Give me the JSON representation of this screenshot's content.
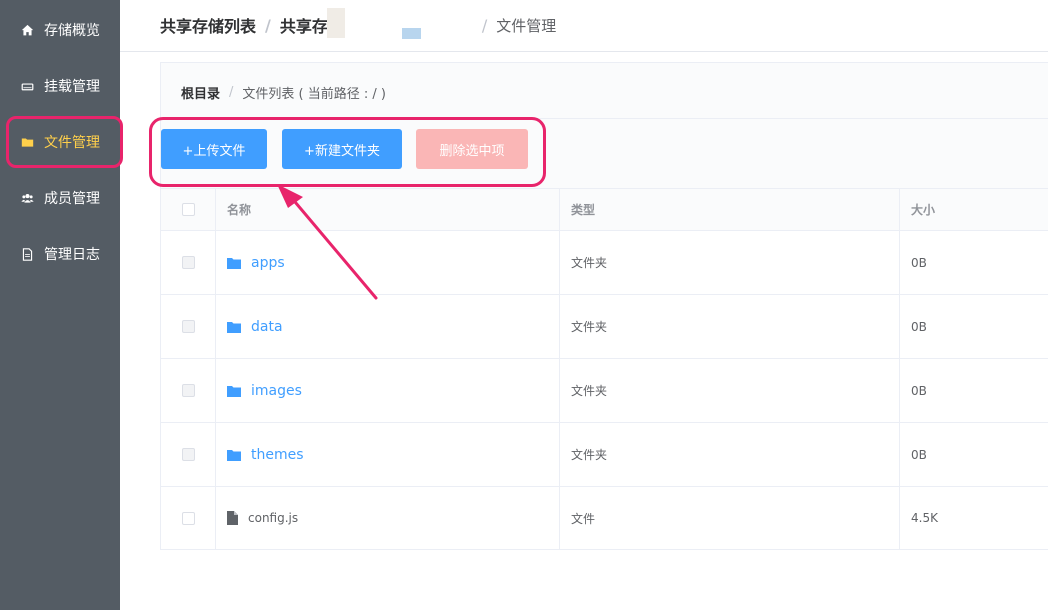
{
  "sidebar": {
    "items": [
      {
        "label": "存储概览",
        "icon": "home-icon"
      },
      {
        "label": "挂载管理",
        "icon": "hard-drive-icon"
      },
      {
        "label": "文件管理",
        "icon": "folder-icon"
      },
      {
        "label": "成员管理",
        "icon": "users-icon"
      },
      {
        "label": "管理日志",
        "icon": "document-icon"
      }
    ],
    "active_color": "#ffd04b",
    "bg_color": "#545c64"
  },
  "header": {
    "crumb1": "共享存储列表",
    "crumb2": "共享存",
    "crumb3": "文件管理",
    "sep": "/"
  },
  "subcrumbs": {
    "root": "根目录",
    "sep": "/",
    "path": "文件列表 ( 当前路径 : / )"
  },
  "toolbar": {
    "upload_label": "+上传文件",
    "newdir_label": "+新建文件夹",
    "delete_label": "删除选中项"
  },
  "table": {
    "columns": [
      "名称",
      "类型",
      "大小"
    ],
    "rows": [
      {
        "name": "apps",
        "type": "文件夹",
        "size": "0B",
        "kind": "folder"
      },
      {
        "name": "data",
        "type": "文件夹",
        "size": "0B",
        "kind": "folder"
      },
      {
        "name": "images",
        "type": "文件夹",
        "size": "0B",
        "kind": "folder"
      },
      {
        "name": "themes",
        "type": "文件夹",
        "size": "0B",
        "kind": "folder"
      },
      {
        "name": "config.js",
        "type": "文件",
        "size": "4.5K",
        "kind": "file"
      }
    ]
  },
  "colors": {
    "primary": "#409eff",
    "danger_disabled": "#fab6b6",
    "annotation": "#e8246b"
  }
}
